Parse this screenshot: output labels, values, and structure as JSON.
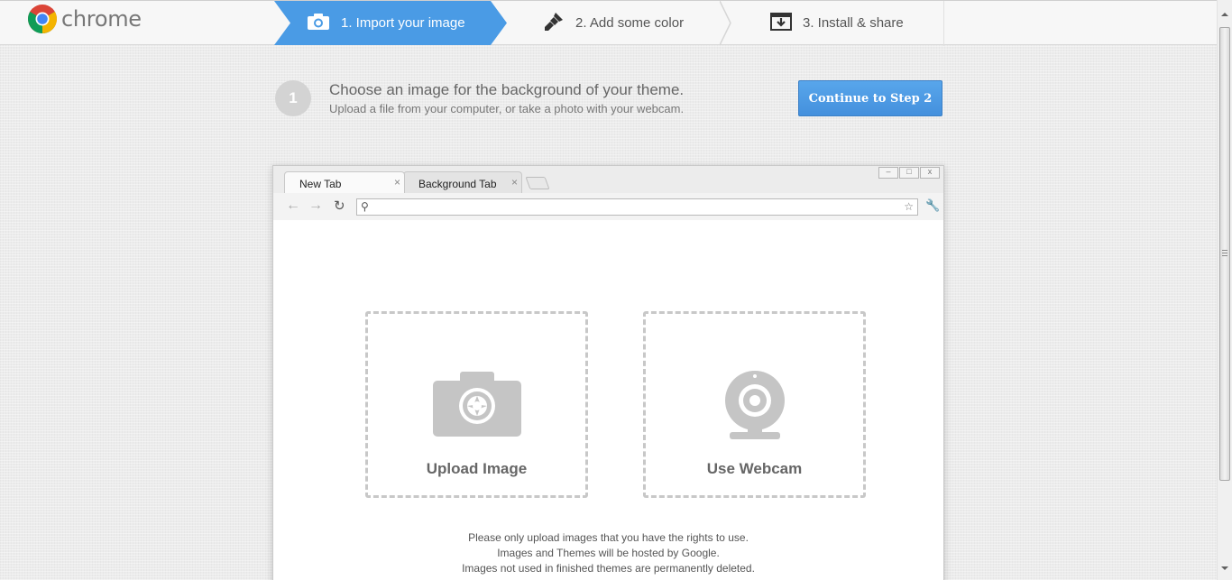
{
  "header": {
    "logo_text": "chrome",
    "steps": [
      {
        "label": "1. Import your image",
        "icon": "camera-icon",
        "active": true
      },
      {
        "label": "2. Add some color",
        "icon": "paintbrush-icon",
        "active": false
      },
      {
        "label": "3. Install & share",
        "icon": "download-icon",
        "active": false
      }
    ]
  },
  "instruction": {
    "step_number": "1",
    "title": "Choose an image for the background of your theme.",
    "subtitle": "Upload a file from your computer, or take a photo with your webcam.",
    "continue_label": "Continue to Step 2"
  },
  "mock_browser": {
    "tabs": [
      {
        "label": "New Tab",
        "close": "×"
      },
      {
        "label": "Background Tab",
        "close": "×"
      }
    ],
    "window_controls": [
      "–",
      "□",
      "x"
    ]
  },
  "options": {
    "upload_label": "Upload Image",
    "webcam_label": "Use Webcam"
  },
  "notes": [
    "Please only upload images that you have the rights to use.",
    "Images and Themes will be hosted by Google.",
    "Images not used in finished themes are permanently deleted."
  ],
  "colors": {
    "accent": "#4a9be5",
    "button": "#4a96e3",
    "placeholder_gray": "#c8c8c8"
  }
}
